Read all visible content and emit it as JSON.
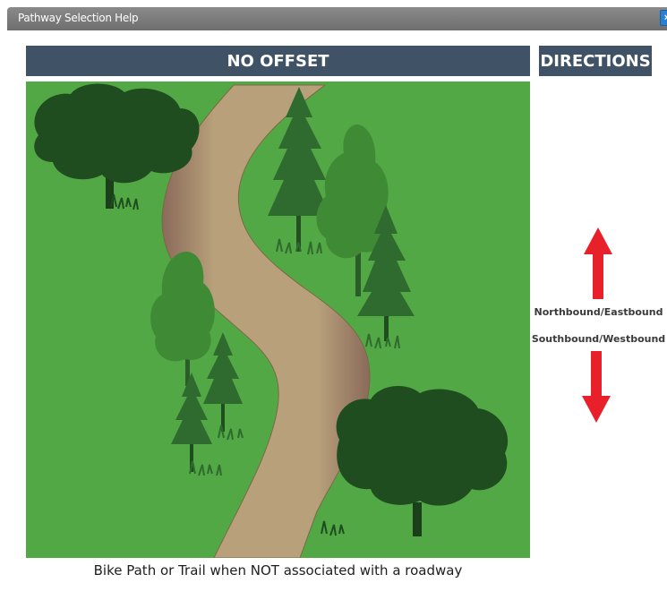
{
  "window": {
    "title": "Pathway Selection Help",
    "close_label": "×"
  },
  "headers": {
    "main": "NO OFFSET",
    "directions": "DIRECTIONS"
  },
  "directions": {
    "up_label": "Northbound/Eastbound",
    "down_label": "Southbound/Westbound",
    "arrow_color": "#e8202a"
  },
  "caption": "Bike Path or Trail when NOT associated with a roadway",
  "colors": {
    "header_bg": "#3f5266",
    "grass": "#52a844",
    "path": "#b79c72",
    "tree_dark": "#1f4d1f",
    "tree_mid": "#2f6b2f",
    "tree_light": "#3f8a34"
  }
}
